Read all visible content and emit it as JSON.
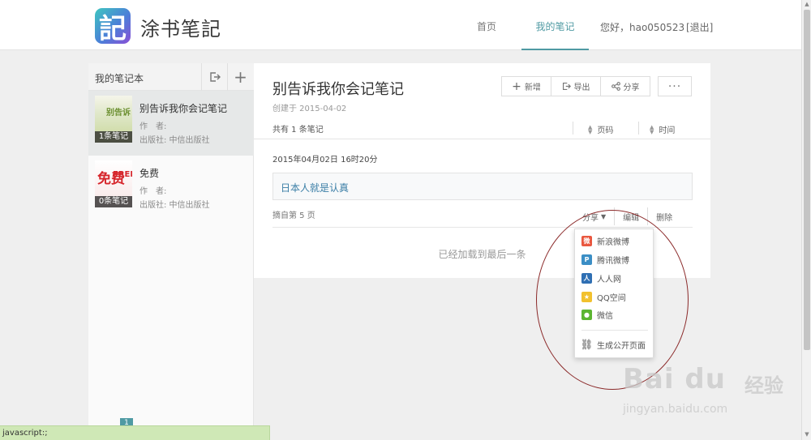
{
  "header": {
    "logo_glyph": "記",
    "app_name": "涂书笔記",
    "nav_home": "首页",
    "nav_notes": "我的笔记",
    "greeting": "您好，hao050523",
    "logout": "[退出]"
  },
  "sidebar": {
    "title": "我的笔记本",
    "books": [
      {
        "title": "别告诉我你会记笔记",
        "author": "作　者:",
        "publisher": "出版社: 中信出版社",
        "count": "1条笔记",
        "cover_text": "别告诉"
      },
      {
        "title": "免费",
        "author": "作　者:",
        "publisher": "出版社: 中信出版社",
        "count": "0条笔记",
        "cover_text": "免费",
        "cover_sub": "FREE"
      }
    ],
    "page": "1"
  },
  "main": {
    "title": "别告诉我你会记笔记",
    "created": "创建于 2015-04-02",
    "actions": {
      "new": "新增",
      "export": "导出",
      "share": "分享",
      "more": "···"
    },
    "count_text": "共有 1 条笔记",
    "sort_page": "页码",
    "sort_time": "时间",
    "note": {
      "date": "2015年04月02日 16时20分",
      "content": "日本人就是认真",
      "page_ref": "摘自第 5 页",
      "share": "分享",
      "edit": "编辑",
      "delete": "删除"
    },
    "loaded_text": "已经加载到最后一条"
  },
  "share_menu": {
    "items": [
      "新浪微博",
      "腾讯微博",
      "人人网",
      "QQ空间",
      "微信"
    ],
    "public_page": "生成公开页面"
  },
  "watermark": {
    "brand": "Bai du",
    "cn": "经验",
    "url": "jingyan.baidu.com"
  },
  "statusbar": {
    "text": "javascript:;"
  },
  "colors": {
    "accent": "#4f9aa3",
    "note_link": "#3a7ea6",
    "annotation": "#8b2a2a",
    "status_bg": "#cfe8b6"
  }
}
